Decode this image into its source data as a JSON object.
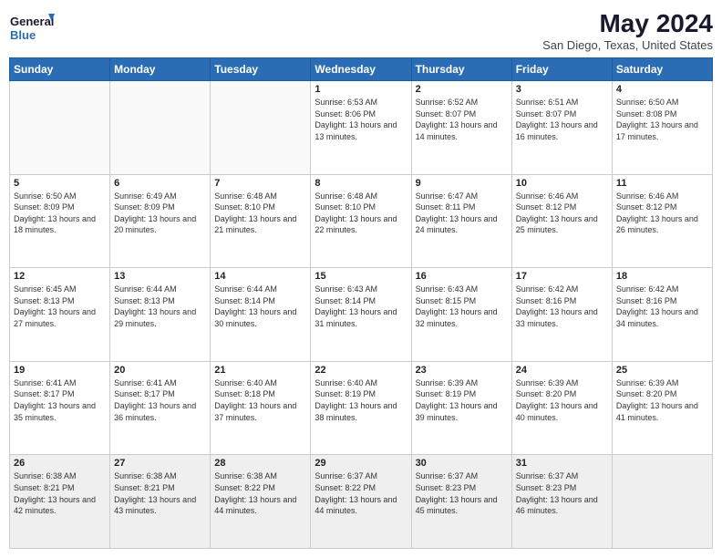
{
  "logo": {
    "line1": "General",
    "line2": "Blue"
  },
  "title": "May 2024",
  "subtitle": "San Diego, Texas, United States",
  "days_of_week": [
    "Sunday",
    "Monday",
    "Tuesday",
    "Wednesday",
    "Thursday",
    "Friday",
    "Saturday"
  ],
  "weeks": [
    [
      {
        "day": "",
        "info": ""
      },
      {
        "day": "",
        "info": ""
      },
      {
        "day": "",
        "info": ""
      },
      {
        "day": "1",
        "info": "Sunrise: 6:53 AM\nSunset: 8:06 PM\nDaylight: 13 hours and 13 minutes."
      },
      {
        "day": "2",
        "info": "Sunrise: 6:52 AM\nSunset: 8:07 PM\nDaylight: 13 hours and 14 minutes."
      },
      {
        "day": "3",
        "info": "Sunrise: 6:51 AM\nSunset: 8:07 PM\nDaylight: 13 hours and 16 minutes."
      },
      {
        "day": "4",
        "info": "Sunrise: 6:50 AM\nSunset: 8:08 PM\nDaylight: 13 hours and 17 minutes."
      }
    ],
    [
      {
        "day": "5",
        "info": "Sunrise: 6:50 AM\nSunset: 8:09 PM\nDaylight: 13 hours and 18 minutes."
      },
      {
        "day": "6",
        "info": "Sunrise: 6:49 AM\nSunset: 8:09 PM\nDaylight: 13 hours and 20 minutes."
      },
      {
        "day": "7",
        "info": "Sunrise: 6:48 AM\nSunset: 8:10 PM\nDaylight: 13 hours and 21 minutes."
      },
      {
        "day": "8",
        "info": "Sunrise: 6:48 AM\nSunset: 8:10 PM\nDaylight: 13 hours and 22 minutes."
      },
      {
        "day": "9",
        "info": "Sunrise: 6:47 AM\nSunset: 8:11 PM\nDaylight: 13 hours and 24 minutes."
      },
      {
        "day": "10",
        "info": "Sunrise: 6:46 AM\nSunset: 8:12 PM\nDaylight: 13 hours and 25 minutes."
      },
      {
        "day": "11",
        "info": "Sunrise: 6:46 AM\nSunset: 8:12 PM\nDaylight: 13 hours and 26 minutes."
      }
    ],
    [
      {
        "day": "12",
        "info": "Sunrise: 6:45 AM\nSunset: 8:13 PM\nDaylight: 13 hours and 27 minutes."
      },
      {
        "day": "13",
        "info": "Sunrise: 6:44 AM\nSunset: 8:13 PM\nDaylight: 13 hours and 29 minutes."
      },
      {
        "day": "14",
        "info": "Sunrise: 6:44 AM\nSunset: 8:14 PM\nDaylight: 13 hours and 30 minutes."
      },
      {
        "day": "15",
        "info": "Sunrise: 6:43 AM\nSunset: 8:14 PM\nDaylight: 13 hours and 31 minutes."
      },
      {
        "day": "16",
        "info": "Sunrise: 6:43 AM\nSunset: 8:15 PM\nDaylight: 13 hours and 32 minutes."
      },
      {
        "day": "17",
        "info": "Sunrise: 6:42 AM\nSunset: 8:16 PM\nDaylight: 13 hours and 33 minutes."
      },
      {
        "day": "18",
        "info": "Sunrise: 6:42 AM\nSunset: 8:16 PM\nDaylight: 13 hours and 34 minutes."
      }
    ],
    [
      {
        "day": "19",
        "info": "Sunrise: 6:41 AM\nSunset: 8:17 PM\nDaylight: 13 hours and 35 minutes."
      },
      {
        "day": "20",
        "info": "Sunrise: 6:41 AM\nSunset: 8:17 PM\nDaylight: 13 hours and 36 minutes."
      },
      {
        "day": "21",
        "info": "Sunrise: 6:40 AM\nSunset: 8:18 PM\nDaylight: 13 hours and 37 minutes."
      },
      {
        "day": "22",
        "info": "Sunrise: 6:40 AM\nSunset: 8:19 PM\nDaylight: 13 hours and 38 minutes."
      },
      {
        "day": "23",
        "info": "Sunrise: 6:39 AM\nSunset: 8:19 PM\nDaylight: 13 hours and 39 minutes."
      },
      {
        "day": "24",
        "info": "Sunrise: 6:39 AM\nSunset: 8:20 PM\nDaylight: 13 hours and 40 minutes."
      },
      {
        "day": "25",
        "info": "Sunrise: 6:39 AM\nSunset: 8:20 PM\nDaylight: 13 hours and 41 minutes."
      }
    ],
    [
      {
        "day": "26",
        "info": "Sunrise: 6:38 AM\nSunset: 8:21 PM\nDaylight: 13 hours and 42 minutes."
      },
      {
        "day": "27",
        "info": "Sunrise: 6:38 AM\nSunset: 8:21 PM\nDaylight: 13 hours and 43 minutes."
      },
      {
        "day": "28",
        "info": "Sunrise: 6:38 AM\nSunset: 8:22 PM\nDaylight: 13 hours and 44 minutes."
      },
      {
        "day": "29",
        "info": "Sunrise: 6:37 AM\nSunset: 8:22 PM\nDaylight: 13 hours and 44 minutes."
      },
      {
        "day": "30",
        "info": "Sunrise: 6:37 AM\nSunset: 8:23 PM\nDaylight: 13 hours and 45 minutes."
      },
      {
        "day": "31",
        "info": "Sunrise: 6:37 AM\nSunset: 8:23 PM\nDaylight: 13 hours and 46 minutes."
      },
      {
        "day": "",
        "info": ""
      }
    ]
  ]
}
